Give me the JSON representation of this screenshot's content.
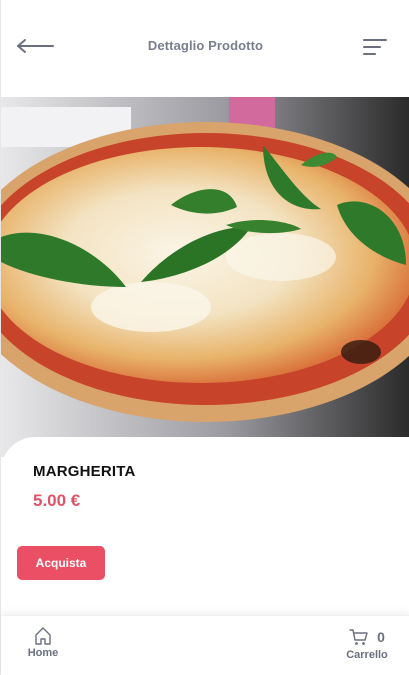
{
  "header": {
    "title": "Dettaglio Prodotto",
    "back_icon": "arrow-left-icon",
    "menu_icon": "menu-icon"
  },
  "product": {
    "image": "pizza-margherita-photo",
    "name": "MARGHERITA",
    "price": "5.00 €",
    "buy_label": "Acquista"
  },
  "bottom_nav": {
    "home_label": "Home",
    "home_icon": "home-icon",
    "cart_label": "Carrello",
    "cart_icon": "cart-icon",
    "cart_count": "0"
  },
  "colors": {
    "accent": "#ea4f65",
    "price": "#e05367",
    "muted_text": "#7a7f8e"
  }
}
